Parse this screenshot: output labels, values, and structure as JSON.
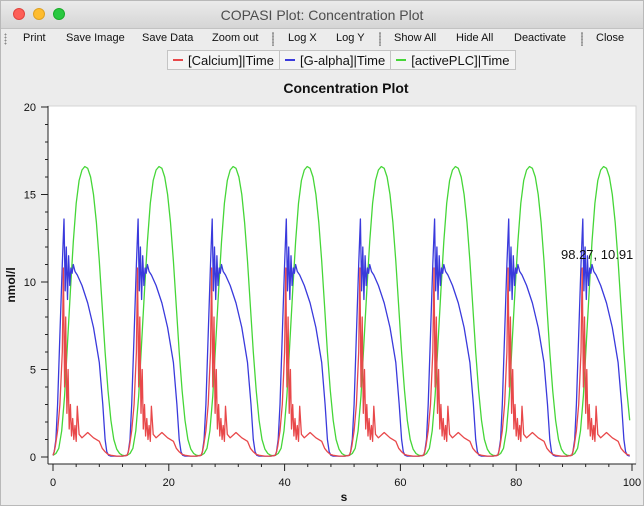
{
  "window": {
    "title": "COPASI Plot: Concentration Plot"
  },
  "toolbar": {
    "print": "Print",
    "save_image": "Save Image",
    "save_data": "Save Data",
    "zoom_out": "Zoom out",
    "log_x": "Log X",
    "log_y": "Log Y",
    "show_all": "Show All",
    "hide_all": "Hide All",
    "deactivate": "Deactivate",
    "close": "Close"
  },
  "legend": [
    {
      "label": "[Calcium]|Time",
      "color": "#e8484a"
    },
    {
      "label": "[G-alpha]|Time",
      "color": "#3a3adc"
    },
    {
      "label": "[activePLC]|Time",
      "color": "#46d638"
    }
  ],
  "cursor_readout": "98.27, 10.91",
  "chart_data": {
    "type": "line",
    "title": "Concentration Plot",
    "xlabel": "s",
    "ylabel": "nmol/l",
    "xlim": [
      0,
      100
    ],
    "ylim": [
      0,
      20
    ],
    "x_ticks": [
      0,
      20,
      40,
      60,
      80,
      100
    ],
    "y_ticks": [
      0,
      5,
      10,
      15,
      20
    ],
    "grid": false,
    "legend_position": "top",
    "period": 12.8,
    "series": [
      {
        "name": "[Calcium]|Time",
        "color": "#e8484a",
        "x": [
          0,
          0.2,
          0.4,
          0.8,
          1.2,
          1.6,
          1.8,
          2.0,
          2.2,
          2.4,
          2.6,
          2.8,
          3.0,
          3.2,
          3.4,
          3.6,
          3.8,
          4.0,
          4.2,
          4.5,
          5.0,
          6.0,
          7.0,
          8.0,
          8.5,
          9.0,
          9.5,
          10.0,
          11.0,
          12.0,
          12.8
        ],
        "y": [
          0.1,
          0.3,
          0.6,
          1.5,
          3.0,
          6.0,
          10.8,
          4.0,
          8.0,
          2.5,
          5.0,
          1.6,
          3.0,
          1.2,
          2.2,
          1.0,
          1.8,
          0.9,
          2.9,
          1.3,
          1.1,
          1.4,
          1.1,
          0.9,
          0.5,
          0.3,
          0.15,
          0.1,
          0.05,
          0.05,
          0.1
        ]
      },
      {
        "name": "[G-alpha]|Time",
        "color": "#3a3adc",
        "x": [
          0,
          0.2,
          0.5,
          0.8,
          1.2,
          1.6,
          1.9,
          2.1,
          2.3,
          2.5,
          2.7,
          2.9,
          3.1,
          3.3,
          3.5,
          3.8,
          4.2,
          5.0,
          6.0,
          7.0,
          8.0,
          8.6,
          9.0,
          9.3,
          9.6,
          10.0,
          11.0,
          12.0,
          12.8
        ],
        "y": [
          0.1,
          0.3,
          1.0,
          3.0,
          7.0,
          11.0,
          13.6,
          9.5,
          12.0,
          9.0,
          11.5,
          9.8,
          10.8,
          10.5,
          11.0,
          10.6,
          10.4,
          9.8,
          8.8,
          7.4,
          5.4,
          3.0,
          1.0,
          0.3,
          0.1,
          0.05,
          0.05,
          0.05,
          0.1
        ]
      },
      {
        "name": "[activePLC]|Time",
        "color": "#46d638",
        "x": [
          0,
          0.5,
          1.0,
          1.5,
          2.0,
          2.5,
          3.0,
          3.5,
          4.0,
          4.5,
          5.0,
          5.5,
          6.0,
          6.5,
          7.0,
          7.5,
          8.0,
          8.5,
          9.0,
          9.5,
          10.0,
          10.5,
          11.0,
          11.5,
          12.0,
          12.4,
          12.8
        ],
        "y": [
          0.1,
          0.2,
          0.5,
          1.5,
          3.5,
          6.5,
          9.5,
          12.3,
          14.5,
          15.8,
          16.4,
          16.6,
          16.5,
          16.0,
          15.0,
          13.4,
          11.2,
          8.6,
          6.0,
          3.8,
          2.1,
          1.0,
          0.45,
          0.2,
          0.1,
          0.08,
          0.1
        ]
      }
    ]
  }
}
